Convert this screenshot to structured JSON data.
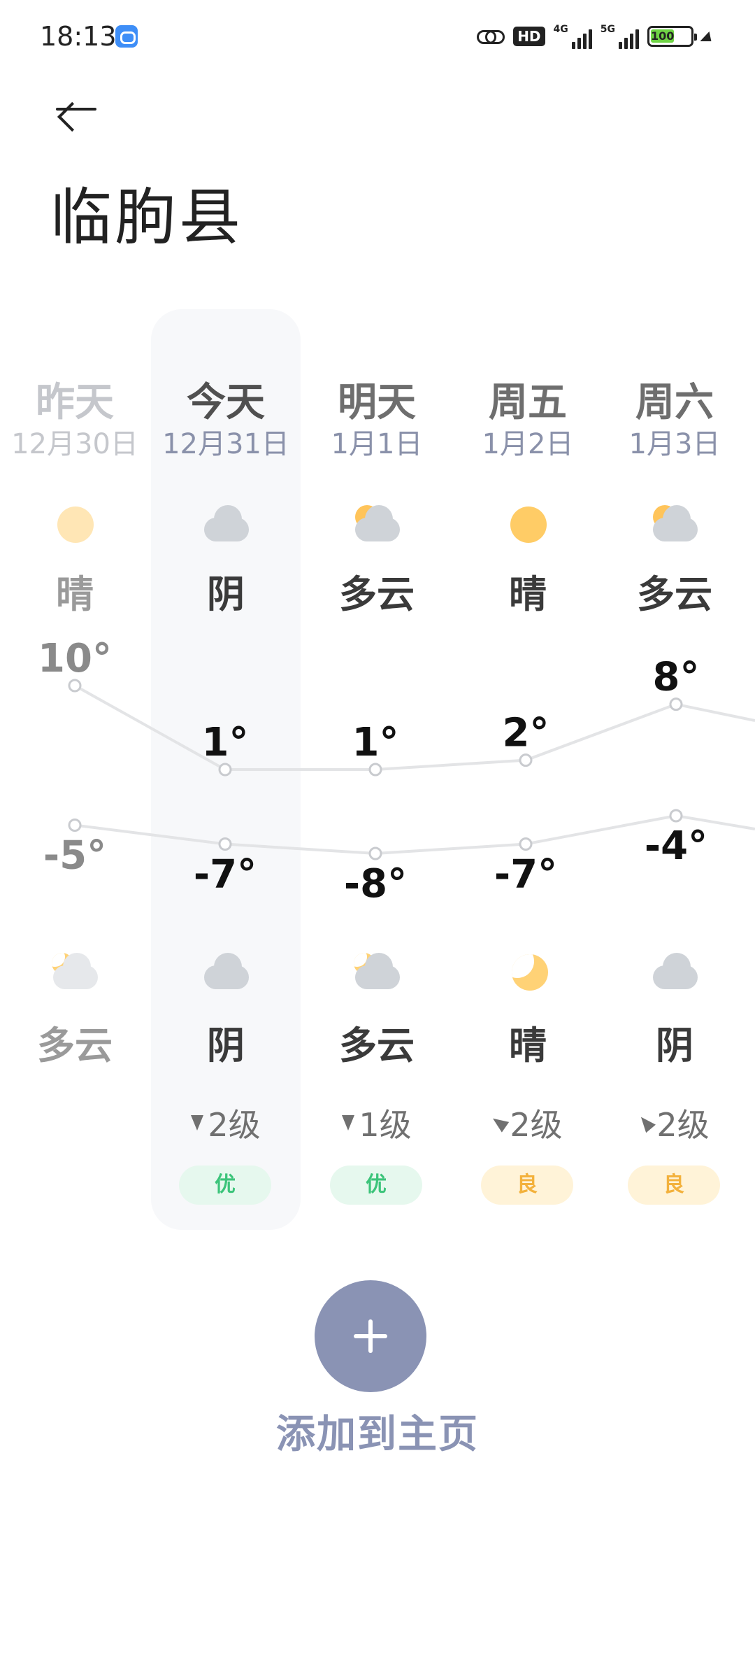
{
  "status_bar": {
    "time": "18:13",
    "hd_label": "HD",
    "signal_1_label": "4G",
    "signal_2_label": "5G",
    "battery": "100"
  },
  "header": {
    "title": "临朐县"
  },
  "days": [
    {
      "name": "昨天",
      "date": "12月30日",
      "day_condition": "晴",
      "day_icon": "sun-icon",
      "high": "10°",
      "low": "-5°",
      "night_condition": "多云",
      "night_icon": "partly-cloudy-night-icon",
      "wind": "",
      "aqi": ""
    },
    {
      "name": "今天",
      "date": "12月31日",
      "day_condition": "阴",
      "day_icon": "cloud-icon",
      "high": "1°",
      "low": "-7°",
      "night_condition": "阴",
      "night_icon": "cloud-icon",
      "wind": "2级",
      "aqi": "优"
    },
    {
      "name": "明天",
      "date": "1月1日",
      "day_condition": "多云",
      "day_icon": "partly-cloudy-icon",
      "high": "1°",
      "low": "-8°",
      "night_condition": "多云",
      "night_icon": "partly-cloudy-night-icon",
      "wind": "1级",
      "aqi": "优"
    },
    {
      "name": "周五",
      "date": "1月2日",
      "day_condition": "晴",
      "day_icon": "sun-icon",
      "high": "2°",
      "low": "-7°",
      "night_condition": "晴",
      "night_icon": "moon-icon",
      "wind": "2级",
      "aqi": "良"
    },
    {
      "name": "周六",
      "date": "1月3日",
      "day_condition": "多云",
      "day_icon": "partly-cloudy-icon",
      "high": "8°",
      "low": "-4°",
      "night_condition": "阴",
      "night_icon": "cloud-icon",
      "wind": "2级",
      "aqi": "良"
    }
  ],
  "colors": {
    "aqi_good": "#3cc47a",
    "aqi_fair": "#f3b13c",
    "accent": "#8a93b4"
  },
  "add": {
    "label": "添加到主页"
  }
}
